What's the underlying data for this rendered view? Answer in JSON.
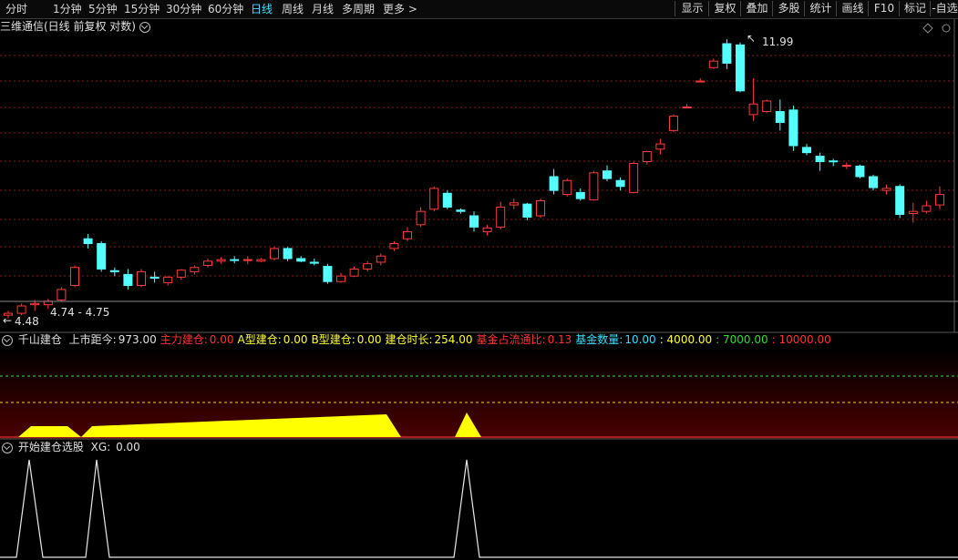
{
  "toolbar": {
    "periods": [
      "分时",
      "1分钟",
      "5分钟",
      "15分钟",
      "30分钟",
      "60分钟",
      "日线",
      "周线",
      "月线",
      "多周期",
      "更多 >"
    ],
    "active_period": "日线",
    "right_buttons": [
      "显示",
      "复权",
      "叠加",
      "多股",
      "统计",
      "画线",
      "F10",
      "标记",
      "-自选"
    ]
  },
  "chart_title": "三维通信(日线 前复权 对数)",
  "price_labels": {
    "high": "11.99",
    "low": "4.48",
    "range": "4.74 - 4.75"
  },
  "indicator1": {
    "name": "千山建仓",
    "items": [
      {
        "label": "上市距今:",
        "value": "973.00",
        "color": "#e0e0e0"
      },
      {
        "label": "主力建仓:",
        "value": "0.00",
        "color": "#ff3333"
      },
      {
        "label": "A型建仓:",
        "value": "0.00",
        "color": "#ffff33"
      },
      {
        "label": "B型建仓:",
        "value": "0.00",
        "color": "#ffff33"
      },
      {
        "label": "建仓时长:",
        "value": "254.00",
        "color": "#ffff33"
      },
      {
        "label": "基金占流通比:",
        "value": "0.13",
        "color": "#ff3333"
      },
      {
        "label": "基金数量:",
        "value": "10.00",
        "color": "#33e0ff"
      }
    ],
    "levels": [
      ": 4000.00",
      ": 7000.00",
      ": 10000.00"
    ],
    "level_colors": [
      "#ffff33",
      "#33dd33",
      "#ff3333"
    ]
  },
  "indicator2": {
    "name": "开始建仓选股",
    "xg_label": "XG:",
    "xg_value": "0.00"
  },
  "colors": {
    "up": "#ff3b3b",
    "down": "#54ffff",
    "grid": "#8b1a1a",
    "yellow": "#ffff00"
  },
  "candles": [
    [
      4.55,
      4.62,
      4.5,
      4.58
    ],
    [
      4.58,
      4.74,
      4.55,
      4.7
    ],
    [
      4.72,
      4.8,
      4.62,
      4.74
    ],
    [
      4.72,
      4.82,
      4.65,
      4.78
    ],
    [
      4.8,
      5.02,
      4.78,
      4.98
    ],
    [
      5.05,
      5.42,
      5.02,
      5.38
    ],
    [
      5.95,
      6.05,
      5.75,
      5.85
    ],
    [
      5.85,
      5.9,
      5.3,
      5.35
    ],
    [
      5.32,
      5.38,
      5.22,
      5.3
    ],
    [
      5.25,
      5.35,
      4.98,
      5.05
    ],
    [
      5.05,
      5.35,
      5.02,
      5.3
    ],
    [
      5.2,
      5.3,
      5.1,
      5.18
    ],
    [
      5.1,
      5.22,
      5.05,
      5.2
    ],
    [
      5.2,
      5.35,
      5.15,
      5.33
    ],
    [
      5.3,
      5.42,
      5.25,
      5.38
    ],
    [
      5.42,
      5.55,
      5.38,
      5.5
    ],
    [
      5.5,
      5.58,
      5.45,
      5.53
    ],
    [
      5.53,
      5.6,
      5.46,
      5.52
    ],
    [
      5.52,
      5.6,
      5.44,
      5.53
    ],
    [
      5.5,
      5.56,
      5.48,
      5.53
    ],
    [
      5.55,
      5.78,
      5.52,
      5.75
    ],
    [
      5.75,
      5.78,
      5.5,
      5.55
    ],
    [
      5.55,
      5.6,
      5.48,
      5.5
    ],
    [
      5.48,
      5.55,
      5.42,
      5.46
    ],
    [
      5.4,
      5.45,
      5.08,
      5.12
    ],
    [
      5.12,
      5.28,
      5.1,
      5.22
    ],
    [
      5.22,
      5.4,
      5.2,
      5.35
    ],
    [
      5.35,
      5.5,
      5.3,
      5.45
    ],
    [
      5.48,
      5.65,
      5.42,
      5.6
    ],
    [
      5.75,
      5.9,
      5.7,
      5.85
    ],
    [
      5.95,
      6.2,
      5.9,
      6.1
    ],
    [
      6.25,
      6.65,
      6.2,
      6.55
    ],
    [
      6.6,
      7.15,
      6.55,
      7.1
    ],
    [
      6.98,
      7.05,
      6.6,
      6.65
    ],
    [
      6.58,
      6.62,
      6.5,
      6.55
    ],
    [
      6.45,
      6.55,
      6.1,
      6.2
    ],
    [
      6.1,
      6.25,
      6.02,
      6.18
    ],
    [
      6.2,
      6.78,
      6.15,
      6.65
    ],
    [
      6.7,
      6.85,
      6.6,
      6.75
    ],
    [
      6.72,
      6.75,
      6.35,
      6.42
    ],
    [
      6.45,
      6.85,
      6.4,
      6.8
    ],
    [
      7.4,
      7.6,
      6.95,
      7.05
    ],
    [
      6.95,
      7.35,
      6.9,
      7.3
    ],
    [
      7.0,
      7.1,
      6.8,
      6.85
    ],
    [
      6.82,
      7.55,
      6.8,
      7.5
    ],
    [
      7.55,
      7.7,
      7.28,
      7.35
    ],
    [
      7.3,
      7.38,
      7.05,
      7.15
    ],
    [
      7.0,
      7.8,
      6.98,
      7.75
    ],
    [
      7.8,
      8.1,
      7.72,
      8.08
    ],
    [
      8.15,
      8.45,
      8.0,
      8.3
    ],
    [
      8.7,
      9.2,
      8.65,
      9.15
    ],
    [
      9.45,
      9.55,
      9.4,
      9.45
    ],
    [
      10.35,
      10.45,
      10.3,
      10.35
    ],
    [
      10.85,
      11.2,
      10.8,
      11.1
    ],
    [
      11.8,
      11.99,
      10.8,
      11.02
    ],
    [
      11.75,
      11.85,
      9.95,
      10.0
    ],
    [
      9.2,
      10.45,
      9.0,
      9.55
    ],
    [
      9.3,
      9.7,
      9.25,
      9.65
    ],
    [
      9.3,
      9.7,
      8.7,
      8.95
    ],
    [
      9.35,
      9.5,
      8.1,
      8.25
    ],
    [
      8.2,
      8.3,
      7.98,
      8.05
    ],
    [
      7.95,
      8.05,
      7.55,
      7.8
    ],
    [
      7.82,
      7.88,
      7.68,
      7.8
    ],
    [
      7.7,
      7.78,
      7.6,
      7.7
    ],
    [
      7.68,
      7.72,
      7.35,
      7.4
    ],
    [
      7.4,
      7.45,
      7.05,
      7.12
    ],
    [
      7.05,
      7.2,
      6.95,
      7.1
    ],
    [
      7.15,
      7.2,
      6.4,
      6.48
    ],
    [
      6.5,
      6.75,
      6.3,
      6.55
    ],
    [
      6.55,
      6.8,
      6.5,
      6.68
    ],
    [
      6.7,
      7.15,
      6.6,
      6.95
    ]
  ]
}
